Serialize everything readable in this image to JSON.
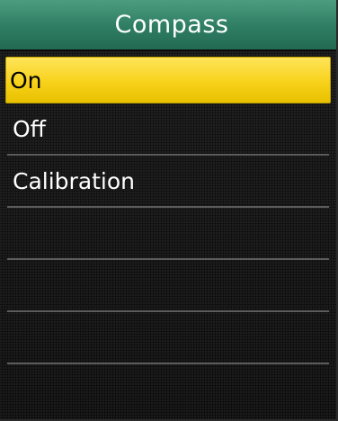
{
  "header": {
    "title": "Compass"
  },
  "menu": {
    "items": [
      {
        "label": "On",
        "selected": true
      },
      {
        "label": "Off",
        "selected": false
      },
      {
        "label": "Calibration",
        "selected": false
      }
    ]
  },
  "colors": {
    "title_bar": "#2e7d63",
    "selection": "#f7d21a",
    "background": "#121212",
    "divider": "#5c5c5c"
  }
}
